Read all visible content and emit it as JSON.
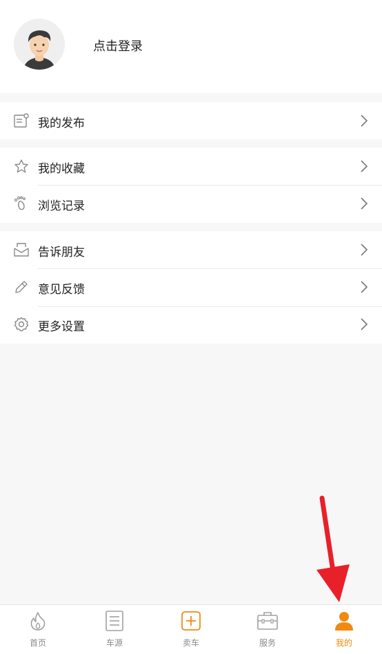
{
  "profile": {
    "login_text": "点击登录"
  },
  "menu": {
    "publish": "我的发布",
    "favorites": "我的收藏",
    "history": "浏览记录",
    "share": "告诉朋友",
    "feedback": "意见反馈",
    "settings": "更多设置"
  },
  "tabbar": {
    "items": [
      {
        "label": "首页",
        "icon": "fire-icon"
      },
      {
        "label": "车源",
        "icon": "list-icon"
      },
      {
        "label": "卖车",
        "icon": "plus-box-icon"
      },
      {
        "label": "服务",
        "icon": "briefcase-icon"
      },
      {
        "label": "我的",
        "icon": "person-icon"
      }
    ],
    "active_index": 4
  },
  "colors": {
    "accent": "#f08a12",
    "arrow": "#e8202a",
    "text": "#222222",
    "muted": "#8a8a8a"
  }
}
